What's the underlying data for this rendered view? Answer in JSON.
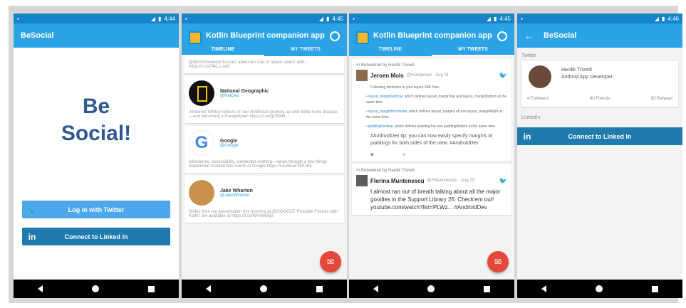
{
  "screens": [
    {
      "status_time": "4:44",
      "app_title": "BeSocial",
      "hero_line1": "Be",
      "hero_line2": "Social!",
      "twitter_button": "Log in with Twitter",
      "linkedin_button": "Connect to Linked In"
    },
    {
      "status_time": "4:45",
      "app_title": "Kotlin Blueprint companion app",
      "tabs": [
        "TIMELINE",
        "MY TWEETS"
      ],
      "active_tab": 0,
      "top_snippet": "@NASAGoddard to learn about our use of 'space lasers' with... https://t.co/74kLLrodb",
      "cards": [
        {
          "name": "National Geographic",
          "handle": "@NatGeo",
          "text": "Jordanne Whiley reflects on her childhood growing up with brittle bone disease—and becoming a Paralympian https://t.co/gCf8hld..."
        },
        {
          "name": "Google",
          "handle": "@Google",
          "text": "Milestones, accessibility, connected clothing—swipe through a few things September marked this month at Google https://t.co/bouFDiP1By"
        },
        {
          "name": "Jake Wharton",
          "handle": "@JakeWharton",
          "text": "Slides from my presentation this morning at @GOOGLE 'Possible Futures with Kotlin' are available at https://t.co/WrSetwbj0"
        }
      ]
    },
    {
      "status_time": "4:45",
      "app_title": "Kotlin Blueprint companion app",
      "tabs": [
        "TIMELINE",
        "MY TWEETS"
      ],
      "active_tab": 1,
      "tweets": [
        {
          "retweet": "Retweeted by Hardik Trivedi",
          "name": "Jeroen Mols",
          "meta": "@molsjeroen · Aug 31",
          "intro": "Following attributes in your layout XML files",
          "bullets": [
            {
              "code": "layout_marginVertical",
              "text": ", which defines layout_marginTop and layout_marginBottom at the same time."
            },
            {
              "code": "layout_marginHorizontal",
              "text": ", which defines layout_marginLeft and layout_marginRight at the same time."
            },
            {
              "code": "paddingVertical",
              "text": ", which defines paddingTop and paddingBottom at the same time."
            }
          ],
          "body": "#AndroidDev tip: you can now easily specify margins or paddings for both sides of the view. #AndroidDev"
        },
        {
          "retweet": "Retweeted by Hardik Trivedi",
          "name": "Florina Muntenescu",
          "meta": "@FMuntenescu · Aug 29",
          "body": "I almost ran out of breath talking about all the major goodies in the Support Library 26. Check'em out! youtube.com/watch?list=PLWz... #AndroidDev"
        }
      ]
    },
    {
      "status_time": "4:46",
      "app_title": "BeSocial",
      "twitter_label": "Twitter",
      "profile_name": "Hardik Trivedi",
      "profile_title": "Android App Developer",
      "stats": [
        "4 Followers",
        "40 Friends",
        "93 Retweet"
      ],
      "linkedin_label": "LinkedIn",
      "linkedin_button": "Connect to Linked In"
    }
  ]
}
